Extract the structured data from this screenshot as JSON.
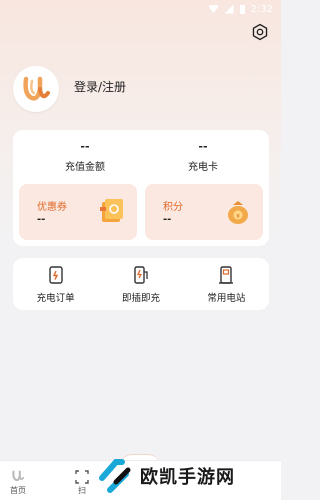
{
  "status_bar": {
    "time": "2:32"
  },
  "header": {
    "login_label": "登录/注册"
  },
  "stats": {
    "balance_value": "--",
    "balance_label": "充值金额",
    "card_value": "--",
    "card_label": "充电卡"
  },
  "sub_cards": {
    "coupon_label": "优惠券",
    "coupon_value": "--",
    "points_label": "积分",
    "points_value": "--"
  },
  "quick_actions": [
    {
      "label": "充电订单",
      "icon": "order-icon"
    },
    {
      "label": "即插即充",
      "icon": "charger-icon"
    },
    {
      "label": "常用电站",
      "icon": "station-icon"
    }
  ],
  "tabbar": {
    "home_label": "首页",
    "scan_label": "扫"
  },
  "watermark": {
    "text": "欧凯手游网"
  },
  "colors": {
    "accent": "#e06a2a",
    "card_tint": "#fbe8e0",
    "hero_top": "#f8e6df",
    "background": "#f2f2f4"
  }
}
